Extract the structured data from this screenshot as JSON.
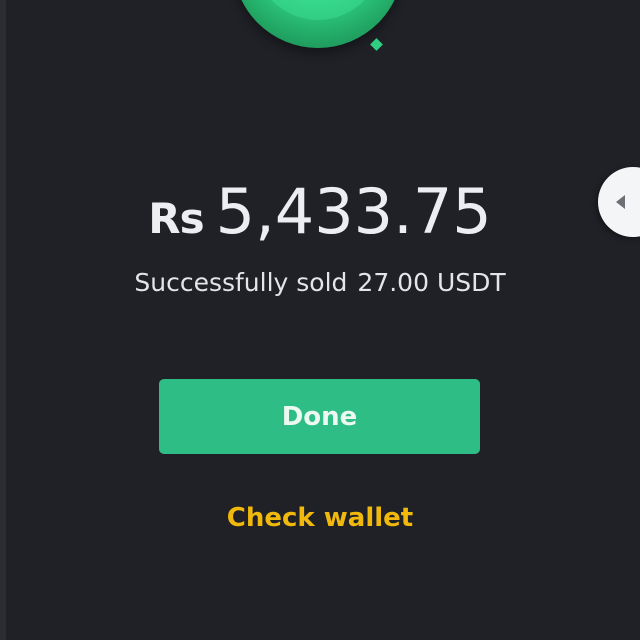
{
  "header_graphic": {
    "icon": "success-check-circle-icon",
    "accent_color": "#2fcf82"
  },
  "result": {
    "currency_symbol": "Rs",
    "amount": "5,433.75",
    "status_text": "Successfully sold",
    "sold_amount": "27.00 USDT"
  },
  "actions": {
    "done_label": "Done",
    "done_color": "#2ebd85",
    "check_wallet_label": "Check wallet",
    "check_wallet_color": "#f0b90b"
  },
  "side_handle": {
    "icon": "chevron-left-icon"
  }
}
